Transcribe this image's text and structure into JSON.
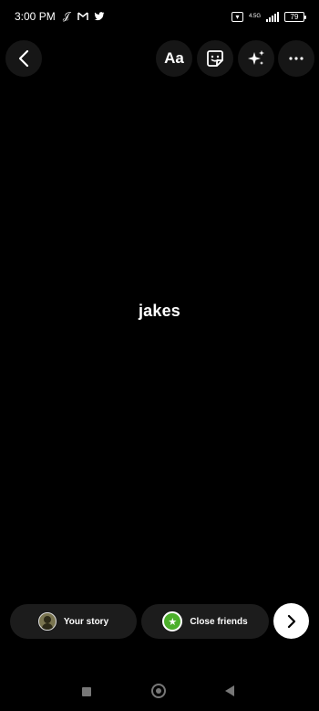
{
  "status_bar": {
    "time": "3:00 PM",
    "battery": "79",
    "network": "4.5G"
  },
  "top_controls": {
    "text_tool_label": "Aa"
  },
  "story": {
    "text": "jakes"
  },
  "share": {
    "your_story_label": "Your story",
    "close_friends_label": "Close friends"
  },
  "colors": {
    "background": "#000000",
    "pill": "#1c1c1c",
    "close_friends_green": "#4caf2b"
  },
  "icons": [
    "back-icon",
    "sticker-icon",
    "effects-sparkle-icon",
    "more-icon",
    "next-arrow-icon",
    "star-icon",
    "recents-icon",
    "home-icon",
    "nav-back-icon"
  ]
}
